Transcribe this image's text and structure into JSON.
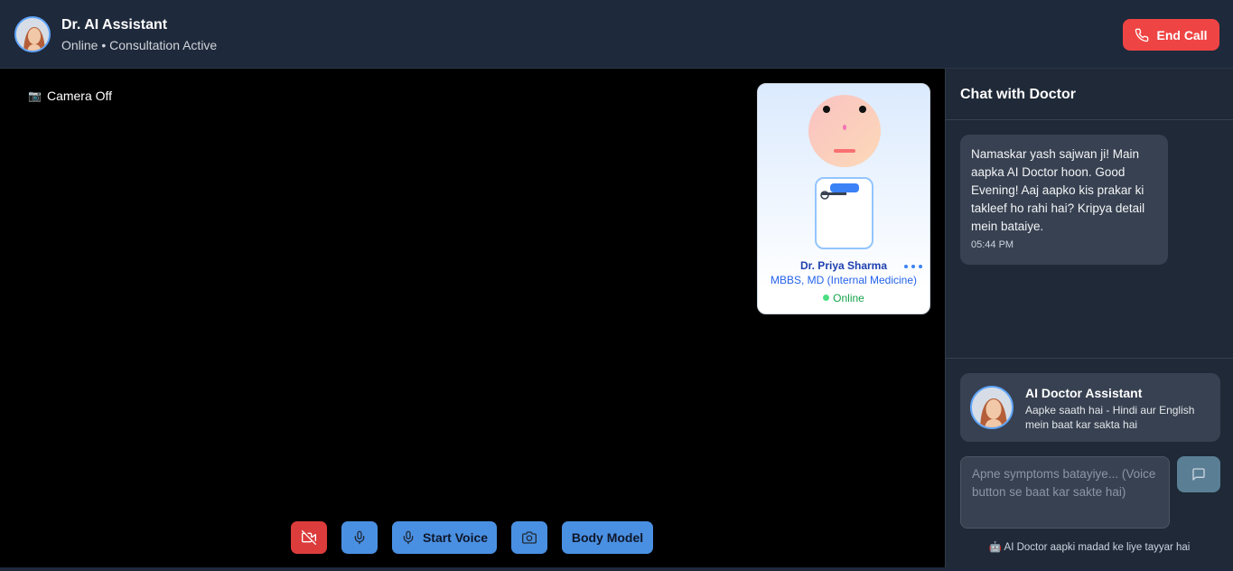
{
  "header": {
    "title": "Dr. AI Assistant",
    "status": "Online • Consultation Active",
    "end_call_label": "End Call",
    "end_call_color": "#ef4444"
  },
  "video": {
    "camera_status": "Camera Off",
    "camera_icon": "camera-icon",
    "doctor_card": {
      "name": "Dr. Priya Sharma",
      "degree": "MBBS, MD (Internal Medicine)",
      "status": "Online"
    },
    "controls": {
      "camera_toggle_icon": "video-off-icon",
      "mic_icon": "microphone-icon",
      "start_voice_label": "Start Voice",
      "snapshot_icon": "camera-icon",
      "body_model_label": "Body Model"
    }
  },
  "chat": {
    "title": "Chat with Doctor",
    "messages": [
      {
        "text": "Namaskar yash sajwan ji! Main aapka AI Doctor hoon. Good Evening! Aaj aapko kis prakar ki takleef ho rahi hai? Kripya detail mein bataiye.",
        "time": "05:44 PM"
      }
    ],
    "assistant": {
      "title": "AI Doctor Assistant",
      "subtitle": "Aapke saath hai - Hindi aur English mein baat kar sakta hai"
    },
    "input_placeholder": "Apne symptoms batayiye... (Voice button se baat kar sakte hai)",
    "send_icon": "message-icon",
    "footer_note": "AI Doctor aapki madad ke liye tayyar hai",
    "footer_icon": "robot-icon"
  }
}
